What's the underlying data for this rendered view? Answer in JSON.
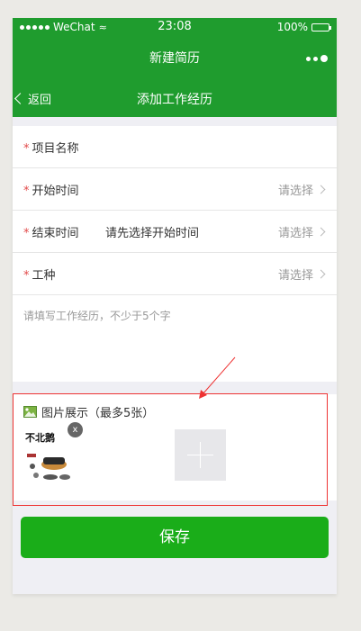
{
  "status_bar": {
    "carrier": "WeChat",
    "time": "23:08",
    "battery": "100%",
    "battery_level": 1.0
  },
  "app_title": "新建简历",
  "nav": {
    "back_label": "返回",
    "title": "添加工作经历"
  },
  "form": {
    "project_name": {
      "label": "项目名称"
    },
    "start_time": {
      "label": "开始时间",
      "value": "请选择"
    },
    "end_time": {
      "label": "结束时间",
      "hint": "请先选择开始时间",
      "value": "请选择"
    },
    "job_type": {
      "label": "工种",
      "value": "请选择"
    },
    "description": {
      "placeholder": "请填写工作经历，不少于5个字"
    }
  },
  "photos": {
    "title": "图片展示（最多5张）",
    "remove_label": "x",
    "thumbnail_text": "不北鹅"
  },
  "save_button": "保存",
  "colors": {
    "brand_green": "#1f9c2e",
    "button_green": "#1aad19",
    "required_red": "#e24a4a",
    "annotation_red": "#ee3333"
  }
}
